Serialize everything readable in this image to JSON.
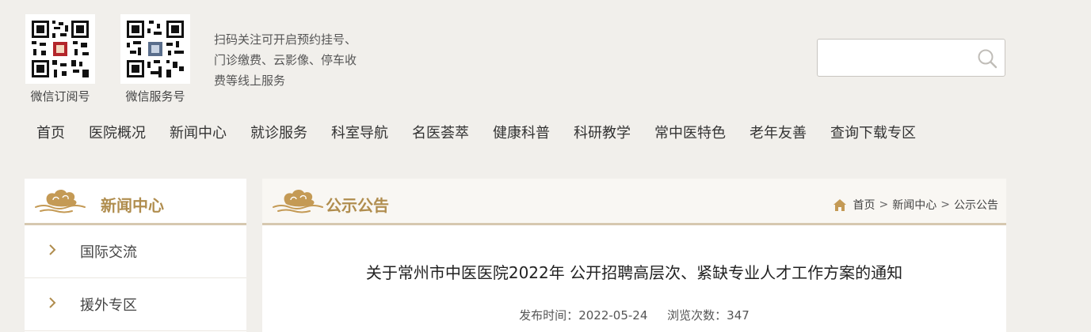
{
  "qr_codes": [
    {
      "caption": "微信订阅号",
      "icon": "qr-code-subscription"
    },
    {
      "caption": "微信服务号",
      "icon": "qr-code-service"
    }
  ],
  "qr_description": [
    "扫码关注可开启预约挂号、",
    "门诊缴费、云影像、停车收",
    "费等线上服务"
  ],
  "search": {
    "placeholder": "",
    "value": "",
    "icon": "search-icon"
  },
  "nav": [
    "首页",
    "医院概况",
    "新闻中心",
    "就诊服务",
    "科室导航",
    "名医荟萃",
    "健康科普",
    "科研教学",
    "常中医特色",
    "老年友善",
    "查询下载专区"
  ],
  "sidebar": {
    "title": "新闻中心",
    "items": [
      {
        "label": "国际交流"
      },
      {
        "label": "援外专区"
      }
    ]
  },
  "main": {
    "title": "公示公告",
    "breadcrumb": [
      "首页",
      "新闻中心",
      "公示公告"
    ],
    "article": {
      "title": "关于常州市中医医院2022年 公开招聘高层次、紧缺专业人才工作方案的通知",
      "publish_label": "发布时间：",
      "publish_date": "2022-05-24",
      "views_label": "浏览次数：",
      "views": "347"
    }
  },
  "colors": {
    "accent": "#b08d4e",
    "background": "#f1efeb",
    "divider": "#d6c8b0"
  }
}
